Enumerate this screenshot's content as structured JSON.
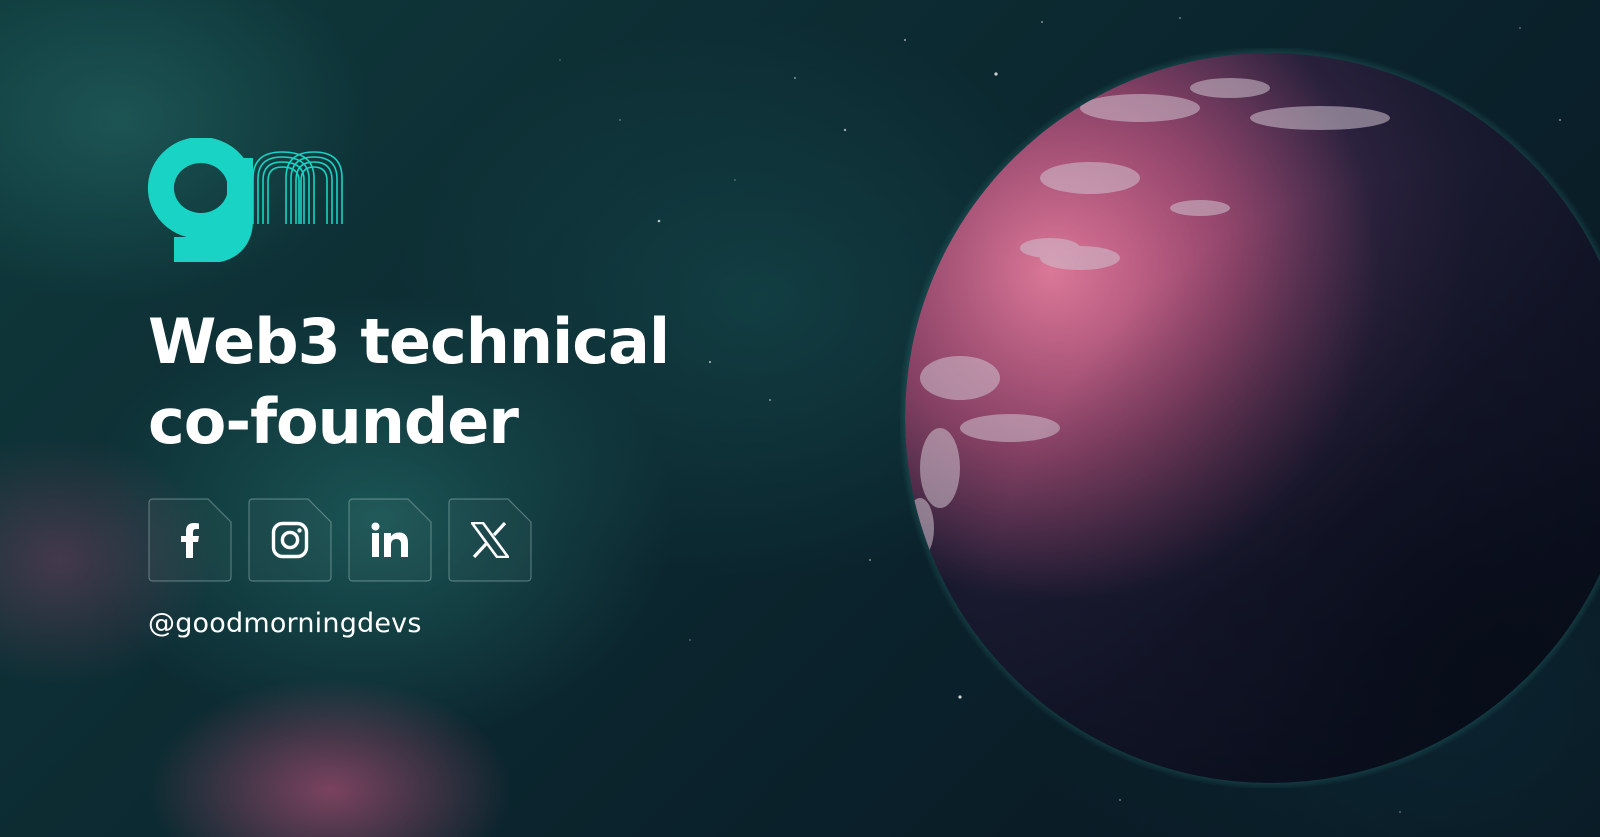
{
  "brand": {
    "logo_text": "gm",
    "logo_color": "#19d3c5"
  },
  "headline": {
    "line1": "Web3 technical",
    "line2": "co-founder"
  },
  "social": [
    {
      "name": "facebook",
      "icon": "facebook-icon"
    },
    {
      "name": "instagram",
      "icon": "instagram-icon"
    },
    {
      "name": "linkedin",
      "icon": "linkedin-icon"
    },
    {
      "name": "x",
      "icon": "x-icon"
    }
  ],
  "handle": "@goodmorningdevs",
  "colors": {
    "text": "#ffffff",
    "accent": "#19d3c5",
    "planet_pink": "#d65a86",
    "background_dark": "#0b1e24"
  }
}
